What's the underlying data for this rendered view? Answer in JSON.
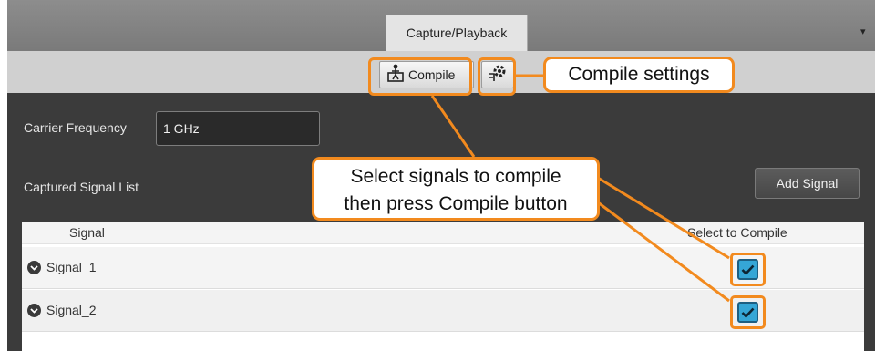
{
  "tabs": [
    {
      "label": "Capture/Playback"
    }
  ],
  "toolbar": {
    "compile_label": "Compile"
  },
  "callouts": {
    "settings": "Compile settings",
    "select_line1": "Select signals to compile",
    "select_line2": "then press Compile button"
  },
  "form": {
    "carrier_label": "Carrier Frequency",
    "carrier_value": "1 GHz"
  },
  "list": {
    "label": "Captured Signal List",
    "add_button": "Add Signal"
  },
  "table": {
    "headers": {
      "signal": "Signal",
      "select": "Select to Compile"
    },
    "rows": [
      {
        "name": "Signal_1",
        "checked": true
      },
      {
        "name": "Signal_2",
        "checked": true
      }
    ]
  },
  "colors": {
    "accent": "#f28a1e",
    "checkbox": "#35a6d6",
    "panel": "#3b3b3b"
  }
}
